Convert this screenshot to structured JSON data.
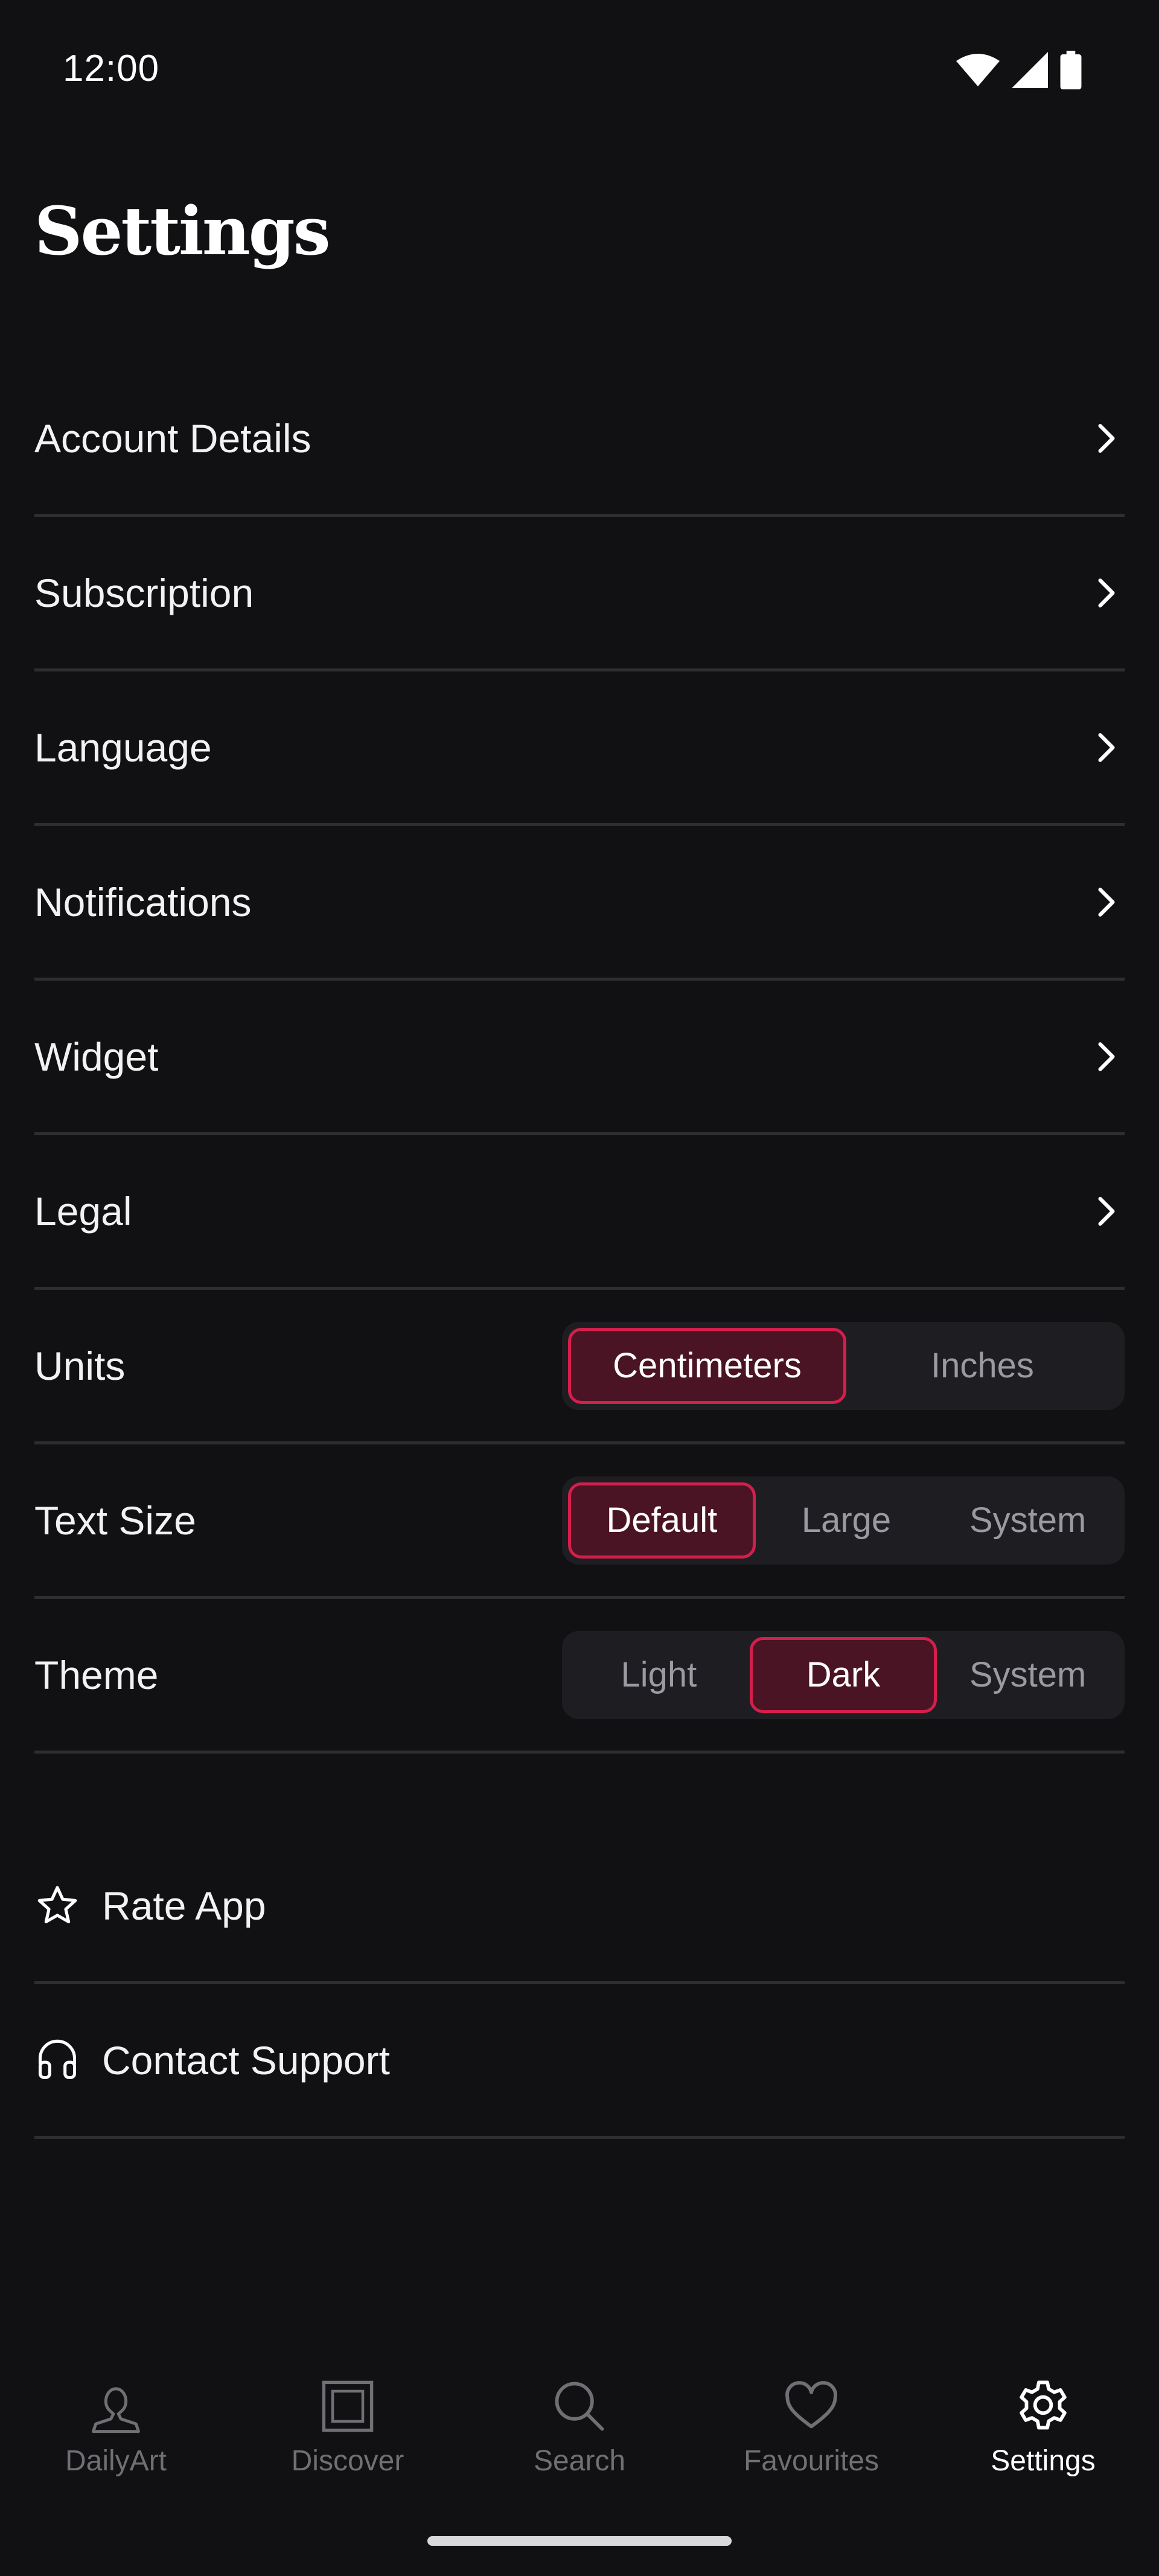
{
  "status_bar": {
    "time": "12:00"
  },
  "header": {
    "title": "Settings"
  },
  "menu_items": [
    {
      "label": "Account Details"
    },
    {
      "label": "Subscription"
    },
    {
      "label": "Language"
    },
    {
      "label": "Notifications"
    },
    {
      "label": "Widget"
    },
    {
      "label": "Legal"
    }
  ],
  "segments": {
    "units": {
      "label": "Units",
      "options": [
        "Centimeters",
        "Inches"
      ],
      "selected": "Centimeters"
    },
    "text_size": {
      "label": "Text Size",
      "options": [
        "Default",
        "Large",
        "System"
      ],
      "selected": "Default"
    },
    "theme": {
      "label": "Theme",
      "options": [
        "Light",
        "Dark",
        "System"
      ],
      "selected": "Dark"
    }
  },
  "actions": [
    {
      "label": "Rate App",
      "icon": "star-icon"
    },
    {
      "label": "Contact Support",
      "icon": "headphones-icon"
    }
  ],
  "bottom_nav": [
    {
      "label": "DailyArt",
      "icon": "bust-icon",
      "active": false
    },
    {
      "label": "Discover",
      "icon": "frame-icon",
      "active": false
    },
    {
      "label": "Search",
      "icon": "search-icon",
      "active": false
    },
    {
      "label": "Favourites",
      "icon": "heart-icon",
      "active": false
    },
    {
      "label": "Settings",
      "icon": "gear-icon",
      "active": true
    }
  ],
  "colors": {
    "background": "#111113",
    "accent": "#d31f4c",
    "accent_fill": "#4a1424",
    "divider": "#2e2e31",
    "inactive": "#6f6f74"
  }
}
